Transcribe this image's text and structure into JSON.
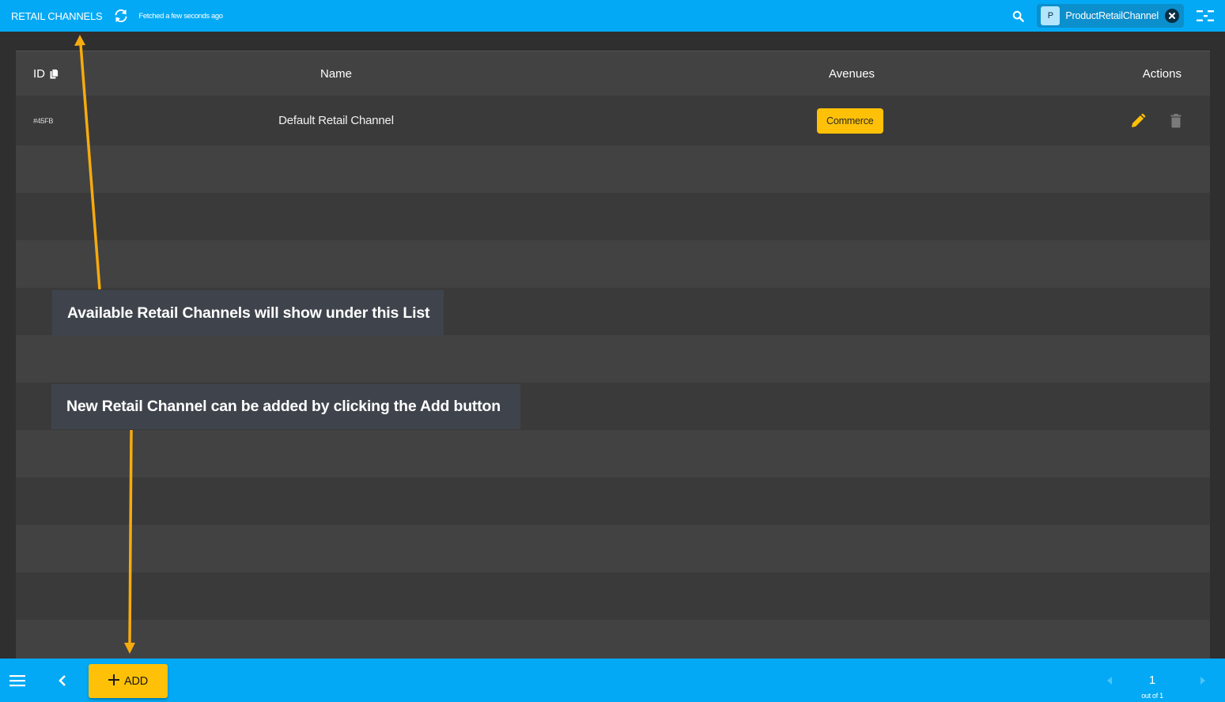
{
  "header": {
    "title": "RETAIL CHANNELS",
    "refresh_icon": "refresh-icon",
    "fetched_status": "Fetched a few seconds ago",
    "search_icon": "search-icon",
    "context_chip": {
      "avatar_letter": "P",
      "label": "ProductRetailChannel",
      "close_icon": "close-circle-icon"
    },
    "filter_icon": "filter-toggle-icon"
  },
  "table": {
    "columns": {
      "id": "ID",
      "name": "Name",
      "avenues": "Avenues",
      "actions": "Actions"
    },
    "copy_icon": "copy-icon",
    "rows": [
      {
        "id": "#45FB",
        "name": "Default Retail Channel",
        "avenues": [
          "Commerce"
        ],
        "actions": [
          "edit-icon",
          "delete-icon"
        ]
      }
    ]
  },
  "annotations": [
    {
      "text": "Available Retail Channels will show under this List"
    },
    {
      "text": "New Retail Channel can be added by clicking the Add button"
    }
  ],
  "footer": {
    "menu_icon": "menu-icon",
    "back_icon": "chevron-left-icon",
    "add_button": {
      "icon": "plus-icon",
      "label": "ADD"
    },
    "pagination": {
      "current_page": "1",
      "total_label": "out of 1"
    }
  },
  "colors": {
    "primary": "#03a9f4",
    "accent": "#ffc107",
    "annotation_arrow": "#f6ab0e",
    "panel": "#3a3a3a"
  }
}
